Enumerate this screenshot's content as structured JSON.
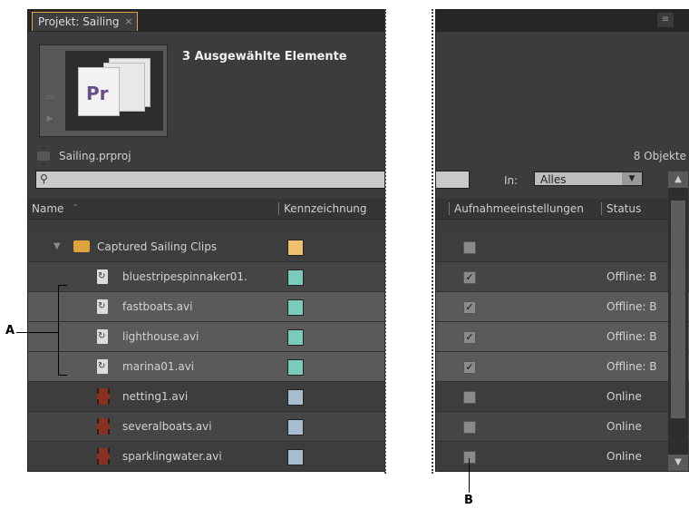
{
  "tab": {
    "label": "Projekt: Sailing",
    "close": "×"
  },
  "preview": {
    "title": "3 Ausgewählte Elemente",
    "pr_logo": "Pr",
    "thumbnail_icon": "premiere-stack-icon"
  },
  "project": {
    "file": "Sailing.prproj",
    "count": "8 Objekte"
  },
  "search": {
    "placeholder": "",
    "icon": "search-icon"
  },
  "filter": {
    "in_label": "In:",
    "in_value": "Alles"
  },
  "columns": {
    "name": "Name",
    "label": "Kennzeichnung",
    "capture": "Aufnahmeeinstellungen",
    "status": "Status"
  },
  "items": [
    {
      "name": "Captured Sailing Clips",
      "type": "folder",
      "color": "#f0c070",
      "checked": false,
      "status": ""
    },
    {
      "name": "bluestripespinnaker01.",
      "type": "file",
      "color": "#7cc9bd",
      "checked": true,
      "status": "Offline: B"
    },
    {
      "name": "fastboats.avi",
      "type": "file",
      "color": "#7cc9bd",
      "checked": true,
      "status": "Offline: B"
    },
    {
      "name": "lighthouse.avi",
      "type": "file",
      "color": "#7cc9bd",
      "checked": true,
      "status": "Offline: B"
    },
    {
      "name": "marina01.avi",
      "type": "file",
      "color": "#7cc9bd",
      "checked": true,
      "status": "Offline: B"
    },
    {
      "name": "netting1.avi",
      "type": "film",
      "color": "#a9bdd0",
      "checked": false,
      "status": "Online"
    },
    {
      "name": "severalboats.avi",
      "type": "film",
      "color": "#a9bdd0",
      "checked": false,
      "status": "Online"
    },
    {
      "name": "sparklingwater.avi",
      "type": "film",
      "color": "#a9bdd0",
      "checked": false,
      "status": "Online"
    }
  ],
  "callouts": {
    "a": "A",
    "b": "B"
  }
}
